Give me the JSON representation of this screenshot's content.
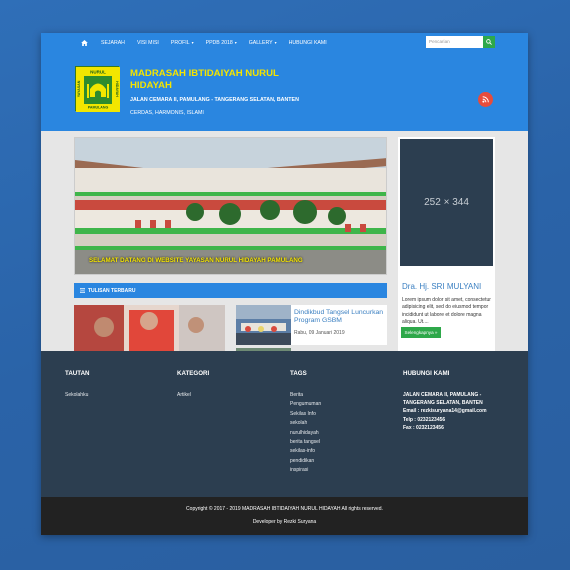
{
  "nav": {
    "items": [
      {
        "label": "SEJARAH",
        "caret": false
      },
      {
        "label": "VISI MISI",
        "caret": false
      },
      {
        "label": "PROFIL",
        "caret": true
      },
      {
        "label": "PPDB 2018",
        "caret": true
      },
      {
        "label": "GALLERY",
        "caret": true
      },
      {
        "label": "HUBUNGI KAMI",
        "caret": false
      }
    ],
    "search_placeholder": "Pencarian"
  },
  "header": {
    "title": "MADRASAH IBTIDAIYAH NURUL HIDAYAH",
    "address": "JALAN CEMARA II, PAMULANG - TANGERANG SELATAN, BANTEN",
    "tagline": "CERDAS, HARMONIS, ISLAMI",
    "logo": {
      "top_text": "NURUL",
      "left_text": "YAYASAN",
      "right_text": "HIDAYAH",
      "bottom_text": "PAMULANG"
    }
  },
  "slider": {
    "caption": "SELAMAT DATANG DI WEBSITE YAYASAN NURUL HIDAYAH PAMULANG"
  },
  "sidebar": {
    "placeholder": "252 × 344",
    "name": "Dra. Hj. SRI MULYANI",
    "text": "Lorem ipsum dolor sit amet, consectetur adipisicing elit, sed do eiusmod tempor incididunt ut labore et dolore magna aliqua. Ut....",
    "button": "Selengkapnya »"
  },
  "latest": {
    "heading": "TULISAN TERBARU",
    "posts": [
      {
        "title": "Dindikbud Tangsel Luncurkan Program GSBM",
        "date": "Rabu, 09 Januari 2019"
      }
    ]
  },
  "footer": {
    "tautan": {
      "heading": "TAUTAN",
      "links": [
        "Sekolahku"
      ]
    },
    "kategori": {
      "heading": "KATEGORI",
      "links": [
        "Artikel"
      ]
    },
    "tags": {
      "heading": "TAGS",
      "links": [
        "Berita",
        "Pengumuman",
        "Sekilas Info",
        "sekolah",
        "nurulhidayah",
        "berita tangsel",
        "sekilas-info",
        "pendidikan",
        "inspirasi"
      ]
    },
    "hubungi": {
      "heading": "HUBUNGI KAMI",
      "lines": [
        "JALAN CEMARA II, PAMULANG -",
        "TANGERANG SELATAN, BANTEN",
        "Email : rezkisuryana14@gmail.com",
        "Telp : 0232123456",
        "Fax : 0232123456"
      ]
    }
  },
  "bottom": {
    "copyright": "Copyright © 2017 - 2019 MADRASAH IBTIDAIYAH NURUL HIDAYAH All rights reserved.",
    "developer": "Developer by Rezki Suryana"
  },
  "colors": {
    "primary": "#2a86e0",
    "title_yellow": "#f4e400",
    "green": "#2ea84a",
    "footer": "#2c3e50",
    "rss": "#e74c3c"
  }
}
